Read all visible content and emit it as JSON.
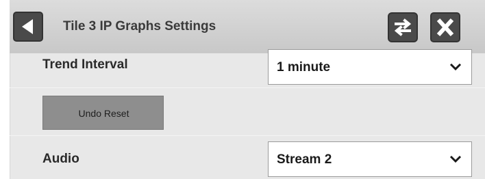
{
  "header": {
    "title": "Tile 3 IP Graphs Settings",
    "back_icon": "back-triangle-icon",
    "refresh_icon": "swap-arrows-icon",
    "close_icon": "close-x-icon"
  },
  "settings": {
    "trend_interval": {
      "label": "Trend Interval",
      "value": "1 minute"
    },
    "undo_reset": {
      "label": "Undo Reset"
    },
    "audio": {
      "label": "Audio",
      "value": "Stream 2"
    }
  },
  "colors": {
    "panel_bg": "#e8e8e8",
    "header_bg": "#d2d2d2",
    "button_dark": "#4a4a4a",
    "undo_button_bg": "#8e8e8e"
  }
}
